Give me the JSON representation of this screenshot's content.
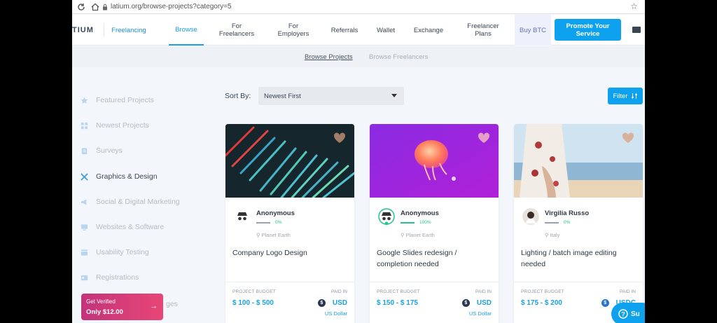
{
  "browser": {
    "url": "latium.org/browse-projects?category=5"
  },
  "header": {
    "logo": "TIUM",
    "nav": [
      {
        "label": "Freelancing"
      },
      {
        "label": "Browse"
      },
      {
        "label": "For Freelancers"
      },
      {
        "label": "For Employers"
      },
      {
        "label": "Referrals"
      },
      {
        "label": "Wallet"
      },
      {
        "label": "Exchange"
      },
      {
        "label": "Freelancer Plans"
      },
      {
        "label": "Buy BTC"
      }
    ],
    "promote_label": "Promote Your Service"
  },
  "subtabs": [
    {
      "label": "Browse Projects",
      "active": true
    },
    {
      "label": "Browse Freelancers",
      "active": false
    }
  ],
  "sidebar": {
    "items": [
      {
        "label": "Featured Projects",
        "icon": "star-icon"
      },
      {
        "label": "Newest Projects",
        "icon": "grid-icon"
      },
      {
        "label": "Surveys",
        "icon": "clipboard-icon"
      },
      {
        "label": "Graphics & Design",
        "icon": "design-tools-icon",
        "active": true
      },
      {
        "label": "Social & Digital Marketing",
        "icon": "megaphone-icon"
      },
      {
        "label": "Websites & Software",
        "icon": "monitor-icon"
      },
      {
        "label": "Usability Testing",
        "icon": "browser-icon"
      },
      {
        "label": "Registrations",
        "icon": "id-card-icon"
      },
      {
        "label": "ges",
        "icon": ""
      }
    ],
    "verify": {
      "line1": "Get Verified",
      "line2": "Only $12.00"
    }
  },
  "sort": {
    "label": "Sort By:",
    "value": "Newest First"
  },
  "filter_label": "Filter",
  "cards": [
    {
      "author": "Anonymous",
      "rating": "0%",
      "location": "Planet Earth",
      "title": "Company Logo Design",
      "budget_label": "PROJECT BUDGET",
      "paid_label": "PAID IN",
      "budget": "$ 100 - $ 500",
      "currency": "USD",
      "currency_name": "US Dollar"
    },
    {
      "author": "Anonymous",
      "rating": "100%",
      "location": "Planet Earth",
      "title": "Google Slides redesign / completion needed",
      "budget_label": "PROJECT BUDGET",
      "paid_label": "PAID IN",
      "budget": "$ 150 - $ 175",
      "currency": "USD",
      "currency_name": "US Dollar"
    },
    {
      "author": "Virgilia Russo",
      "rating": "0%",
      "location": "Italy",
      "title": "Lighting / batch image editing needed",
      "budget_label": "PROJECT BUDGET",
      "paid_label": "PAID IN",
      "budget": "$ 175 - $ 200",
      "currency": "USDC",
      "currency_name": ""
    }
  ],
  "support_label": "Su",
  "colors": {
    "accent": "#0ea2ee",
    "success": "#21c38e",
    "verify_start": "#c2347a",
    "verify_end": "#e84677"
  }
}
